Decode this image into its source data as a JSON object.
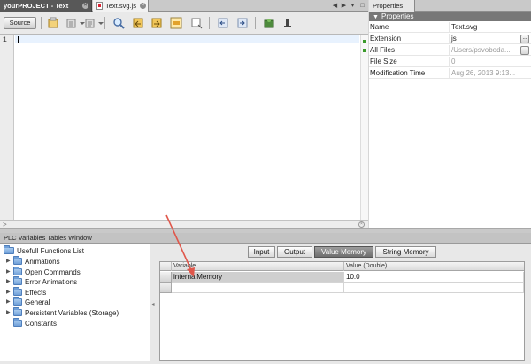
{
  "editor": {
    "tabs": [
      {
        "label": "yourPROJECT - Text",
        "active": false
      },
      {
        "label": "Text.svg.js",
        "active": true
      }
    ],
    "toolbar": {
      "source_label": "Source",
      "icons": [
        "history-icon",
        "back-icon",
        "forward-icon",
        "find-icon",
        "find-previous-icon",
        "find-next-icon",
        "toggle-highlight-icon",
        "toggle-bookmark-icon",
        "shift-left-icon",
        "shift-right-icon",
        "macro-record-icon",
        "macro-stop-icon"
      ]
    },
    "line_number": "1",
    "accent_current_line": "#e8f2fe",
    "stripe_color": "#3a9a2a"
  },
  "properties": {
    "tab_label": "Properties",
    "section_label": "Properties",
    "rows": [
      {
        "name": "Name",
        "value": "Text.svg"
      },
      {
        "name": "Extension",
        "value": "js"
      },
      {
        "name": "All Files",
        "value": "/Users/psvoboda..."
      },
      {
        "name": "File Size",
        "value": "0"
      },
      {
        "name": "Modification Time",
        "value": "Aug 26, 2013 9:13..."
      }
    ],
    "more_label": "..."
  },
  "plc": {
    "window_title": "PLC Variables Tables Window",
    "tree": {
      "root": "Usefull Functions List",
      "items": [
        "Animations",
        "Open Commands",
        "Error Animations",
        "Effects",
        "General",
        "Persistent Variables (Storage)",
        "Constants"
      ]
    },
    "tabs": [
      {
        "label": "Input",
        "active": false
      },
      {
        "label": "Output",
        "active": false
      },
      {
        "label": "Value Memory",
        "active": true
      },
      {
        "label": "String Memory",
        "active": false
      }
    ],
    "table": {
      "columns": [
        "Variable",
        "Value (Double)"
      ],
      "rows": [
        {
          "variable": "internalMemory",
          "value": "10.0"
        }
      ]
    }
  },
  "colors": {
    "annotation_arrow": "#e0574b",
    "active_tab": "#585858",
    "folder": "#6f9fd8"
  }
}
